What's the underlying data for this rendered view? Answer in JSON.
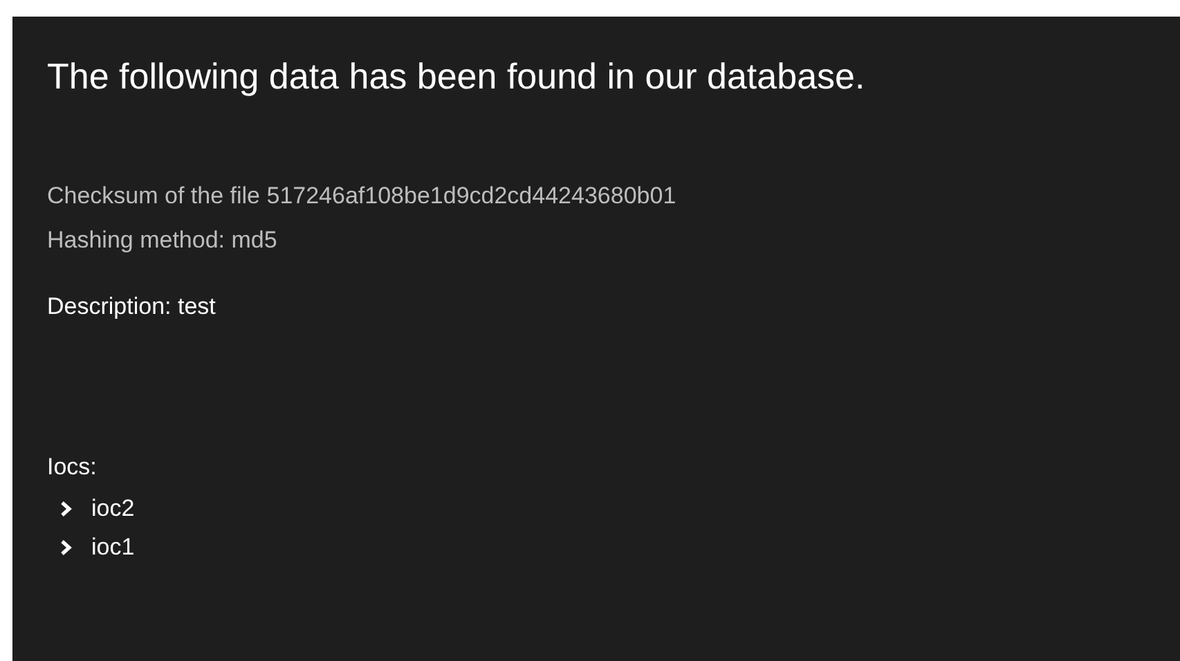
{
  "title": "The following data has been found in our database.",
  "checksum": "Checksum of the file 517246af108be1d9cd2cd44243680b01",
  "hashing_method": "Hashing method: md5",
  "description": "Description: test",
  "iocs": {
    "label": "Iocs:",
    "items": [
      {
        "label": "ioc2",
        "expanded": false
      },
      {
        "label": "ioc1",
        "expanded": false
      }
    ]
  }
}
